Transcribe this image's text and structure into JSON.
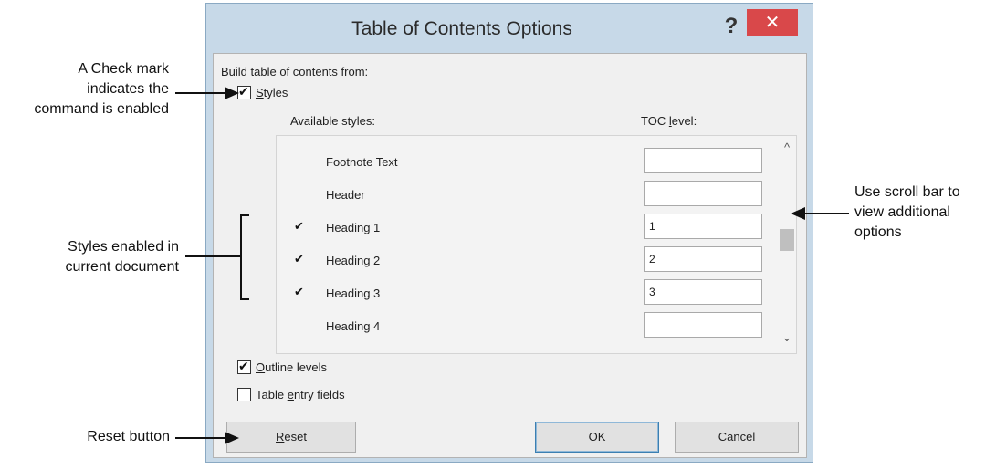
{
  "dialog": {
    "title": "Table of Contents Options",
    "help_glyph": "?",
    "close_glyph": "✕",
    "build_label": "Build table of contents from:",
    "styles_checkbox": {
      "label_first": "S",
      "label_rest": "tyles",
      "checked": true
    },
    "available_styles_header": "Available styles:",
    "toc_level_header_first": "TOC ",
    "toc_level_header_ul": "l",
    "toc_level_header_rest": "evel:",
    "styles_list": [
      {
        "name": "Footnote Text",
        "enabled": false,
        "level": ""
      },
      {
        "name": "Header",
        "enabled": false,
        "level": ""
      },
      {
        "name": "Heading 1",
        "enabled": true,
        "level": "1"
      },
      {
        "name": "Heading 2",
        "enabled": true,
        "level": "2"
      },
      {
        "name": "Heading 3",
        "enabled": true,
        "level": "3"
      },
      {
        "name": "Heading 4",
        "enabled": false,
        "level": ""
      }
    ],
    "outline_levels": {
      "label_first": "O",
      "label_rest": "utline levels",
      "checked": true
    },
    "table_entry_fields": {
      "label_first": "Table ",
      "label_ul": "e",
      "label_rest": "ntry fields",
      "checked": false
    },
    "buttons": {
      "reset_first": "R",
      "reset_rest": "eset",
      "ok": "OK",
      "cancel": "Cancel"
    },
    "tick_glyph": "✔",
    "scroll_up_glyph": "^",
    "scroll_down_glyph": "⌄"
  },
  "annotations": {
    "check_mark": [
      "A Check mark",
      "indicates the",
      "command is enabled"
    ],
    "styles_enabled": [
      "Styles enabled in",
      "current document"
    ],
    "scroll_bar": [
      "Use scroll bar to",
      "view additional",
      "options"
    ],
    "reset_button": "Reset button"
  }
}
